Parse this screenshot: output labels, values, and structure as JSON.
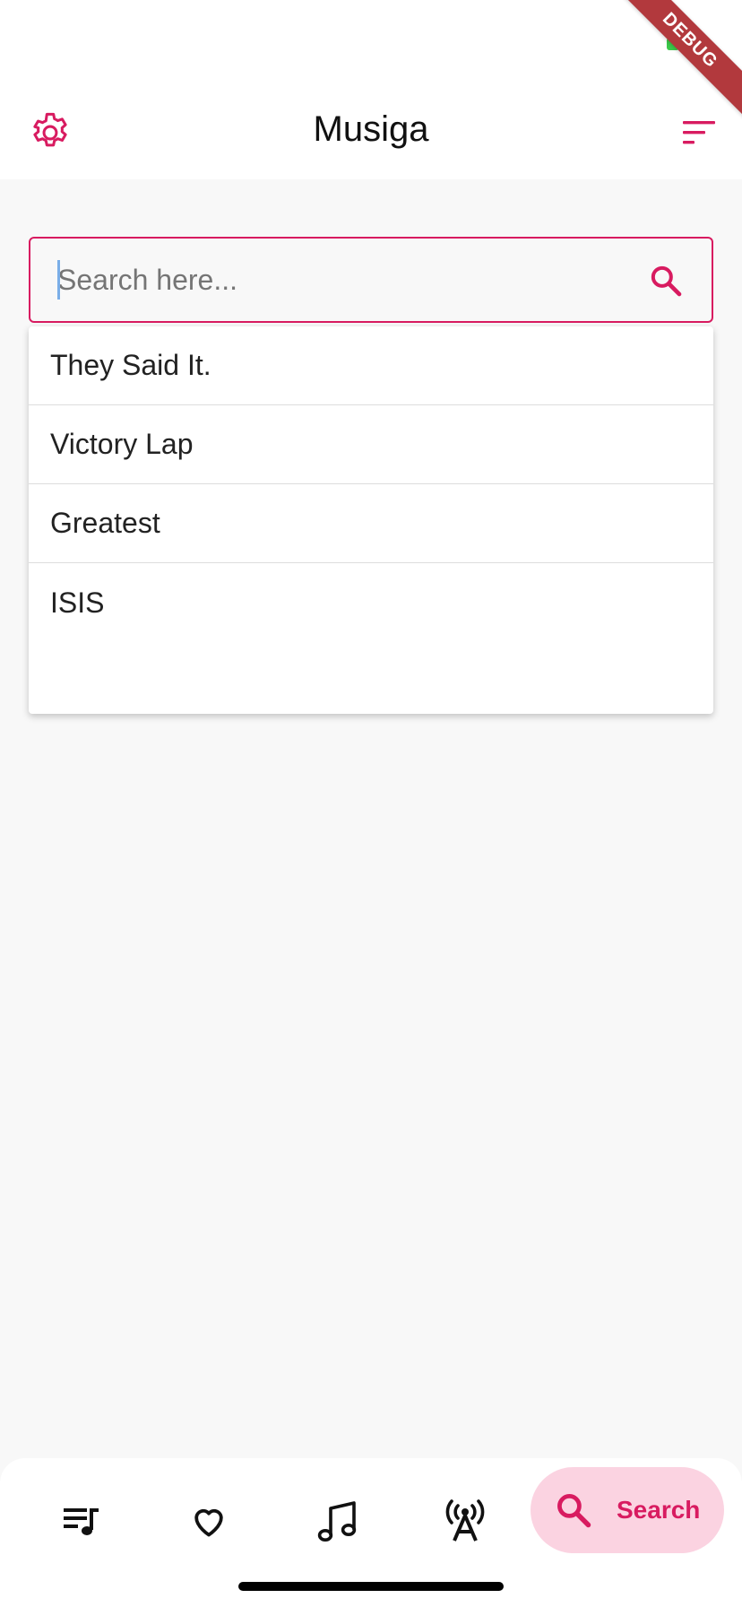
{
  "colors": {
    "accent": "#d81b60",
    "accent_light": "#fbd3e1",
    "background": "#f8f8f8",
    "surface": "#ffffff",
    "debug_ribbon": "#b2393d"
  },
  "status": {
    "debug_label": "DEBUG"
  },
  "header": {
    "title": "Musiga",
    "settings_icon": "gear-icon",
    "sort_icon": "sort-icon"
  },
  "search": {
    "placeholder": "Search here...",
    "value": "",
    "icon": "search-icon"
  },
  "suggestions": [
    {
      "label": "They Said It."
    },
    {
      "label": "Victory Lap"
    },
    {
      "label": "Greatest"
    },
    {
      "label": "ISIS"
    }
  ],
  "bottom_nav": {
    "items": [
      {
        "icon": "queue-music-icon"
      },
      {
        "icon": "heart-icon"
      },
      {
        "icon": "music-note-icon"
      },
      {
        "icon": "radio-tower-icon"
      },
      {
        "icon": "search-icon",
        "label": "Search",
        "selected": true
      }
    ]
  }
}
